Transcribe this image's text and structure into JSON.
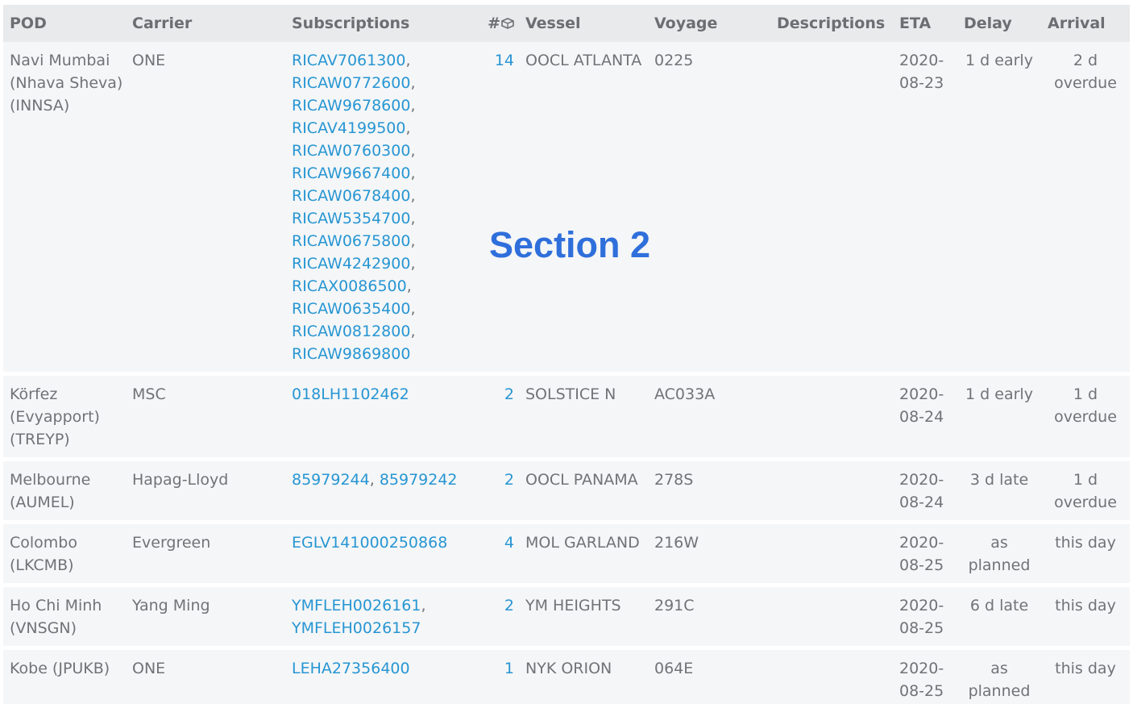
{
  "header": {
    "pod": "POD",
    "carrier": "Carrier",
    "subscriptions": "Subscriptions",
    "count": "#",
    "count_icon": "container-icon",
    "vessel": "Vessel",
    "voyage": "Voyage",
    "descriptions": "Descriptions",
    "eta": "ETA",
    "delay": "Delay",
    "arrival": "Arrival"
  },
  "overlay": {
    "section_label": "Section 2"
  },
  "rows": [
    {
      "pod": "Navi Mumbai (Nhava Sheva) (INNSA)",
      "carrier": "ONE",
      "subscriptions": [
        "RICAV7061300",
        "RICAW0772600",
        "RICAW9678600",
        "RICAV4199500",
        "RICAW0760300",
        "RICAW9667400",
        "RICAW0678400",
        "RICAW5354700",
        "RICAW0675800",
        "RICAW4242900",
        "RICAX0086500",
        "RICAW0635400",
        "RICAW0812800",
        "RICAW9869800"
      ],
      "count": "14",
      "vessel": "OOCL ATLANTA",
      "voyage": "0225",
      "descriptions": "",
      "eta": "2020-08-23",
      "delay": "1 d early",
      "arrival": "2 d overdue"
    },
    {
      "pod": "Körfez (Evyapport) (TREYP)",
      "carrier": "MSC",
      "subscriptions": [
        "018LH1102462"
      ],
      "count": "2",
      "vessel": "SOLSTICE N",
      "voyage": "AC033A",
      "descriptions": "",
      "eta": "2020-08-24",
      "delay": "1 d early",
      "arrival": "1 d overdue"
    },
    {
      "pod": "Melbourne (AUMEL)",
      "carrier": "Hapag-Lloyd",
      "subscriptions": [
        "85979244",
        "85979242"
      ],
      "count": "2",
      "vessel": "OOCL PANAMA",
      "voyage": "278S",
      "descriptions": "",
      "eta": "2020-08-24",
      "delay": "3 d late",
      "arrival": "1 d overdue"
    },
    {
      "pod": "Colombo (LKCMB)",
      "carrier": "Evergreen",
      "subscriptions": [
        "EGLV141000250868"
      ],
      "count": "4",
      "vessel": "MOL GARLAND",
      "voyage": "216W",
      "descriptions": "",
      "eta": "2020-08-25",
      "delay": "as planned",
      "arrival": "this day"
    },
    {
      "pod": "Ho Chi Minh (VNSGN)",
      "carrier": "Yang Ming",
      "subscriptions": [
        "YMFLEH0026161",
        "YMFLEH0026157"
      ],
      "count": "2",
      "vessel": "YM HEIGHTS",
      "voyage": "291C",
      "descriptions": "",
      "eta": "2020-08-25",
      "delay": "6 d late",
      "arrival": "this day"
    },
    {
      "pod": "Kobe (JPUKB)",
      "carrier": "ONE",
      "subscriptions": [
        "LEHA27356400"
      ],
      "count": "1",
      "vessel": "NYK ORION",
      "voyage": "064E",
      "descriptions": "",
      "eta": "2020-08-25",
      "delay": "as planned",
      "arrival": "this day"
    }
  ],
  "colors": {
    "link": "#2796d3",
    "text": "#707377",
    "header_bg": "#e9eaeb",
    "row_bg": "#f5f6f7",
    "section_label": "#2f6fdb"
  }
}
